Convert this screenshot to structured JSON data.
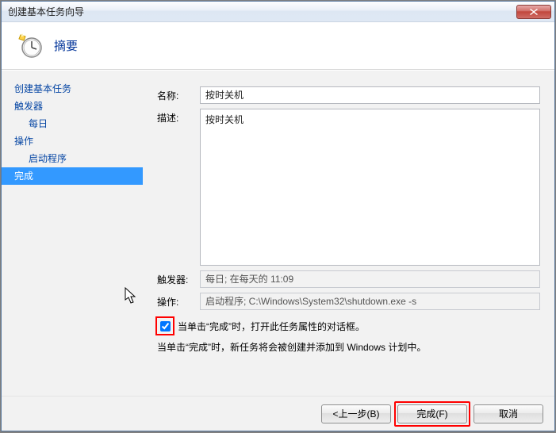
{
  "window": {
    "title": "创建基本任务向导"
  },
  "header": {
    "title": "摘要"
  },
  "sidebar": {
    "items": [
      {
        "label": "创建基本任务",
        "indent": false,
        "selected": false
      },
      {
        "label": "触发器",
        "indent": false,
        "selected": false
      },
      {
        "label": "每日",
        "indent": true,
        "selected": false
      },
      {
        "label": "操作",
        "indent": false,
        "selected": false
      },
      {
        "label": "启动程序",
        "indent": true,
        "selected": false
      },
      {
        "label": "完成",
        "indent": false,
        "selected": true
      }
    ]
  },
  "form": {
    "name_label": "名称:",
    "name_value": "按时关机",
    "desc_label": "描述:",
    "desc_value": "按时关机",
    "trigger_label": "触发器:",
    "trigger_value": "每日; 在每天的 11:09",
    "action_label": "操作:",
    "action_value": "启动程序; C:\\Windows\\System32\\shutdown.exe -s",
    "checkbox_label": "当单击“完成”时，打开此任务属性的对话框。",
    "hint_text": "当单击“完成”时，新任务将会被创建并添加到 Windows 计划中。"
  },
  "buttons": {
    "back": "<上一步(B)",
    "finish": "完成(F)",
    "cancel": "取消"
  }
}
